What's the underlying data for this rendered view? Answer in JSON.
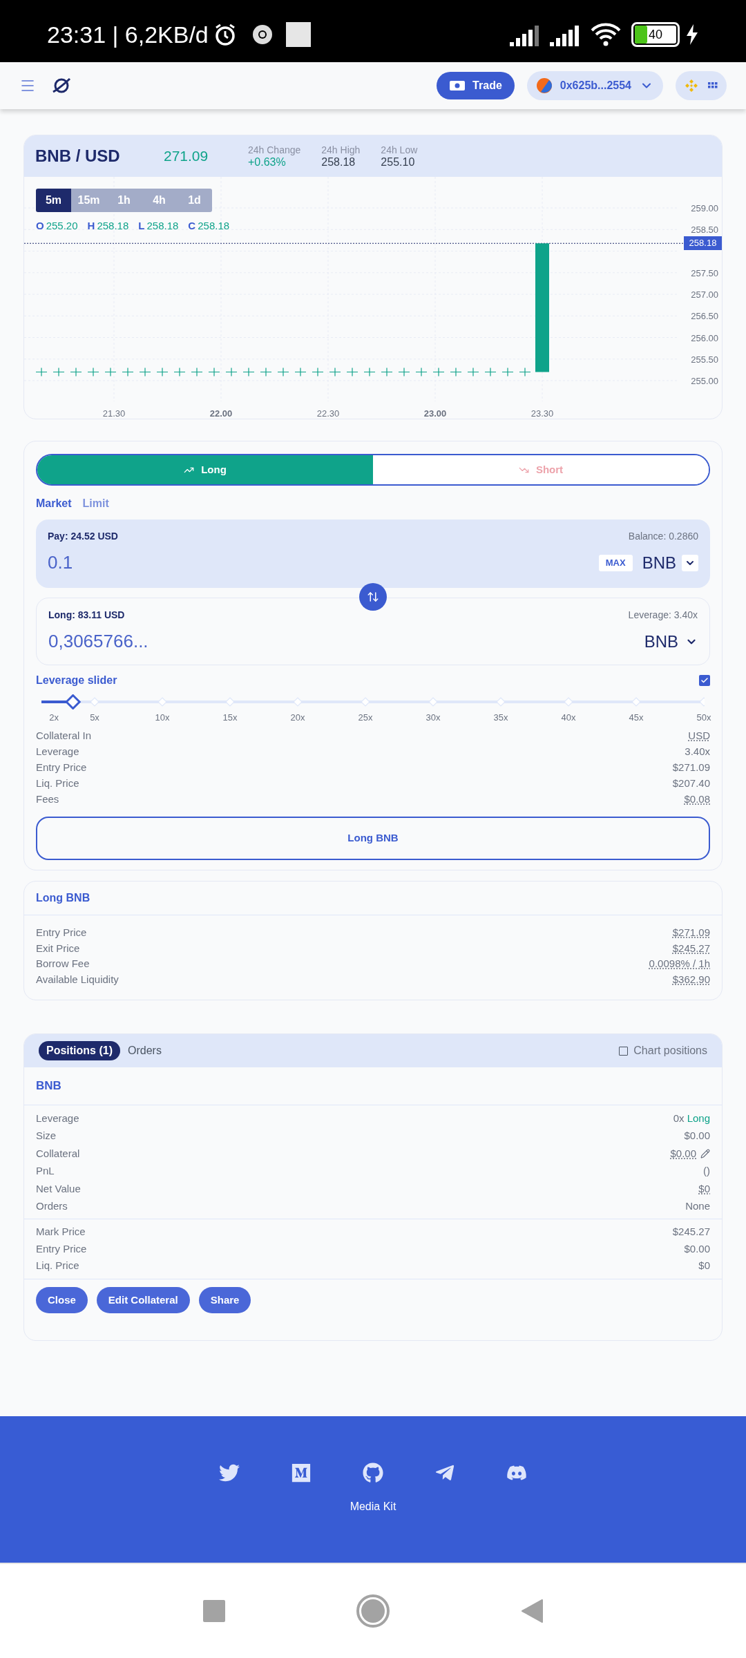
{
  "status_bar": {
    "time": "23:31 | 6,2KB/d",
    "battery": "40"
  },
  "header": {
    "trade_button": "Trade",
    "wallet": "0x625b...2554"
  },
  "market": {
    "pair": "BNB / USD",
    "price": "271.09",
    "stats": [
      {
        "label": "24h Change",
        "value": "+0.63%",
        "kind": "change"
      },
      {
        "label": "24h High",
        "value": "258.18",
        "kind": "plain"
      },
      {
        "label": "24h Low",
        "value": "255.10",
        "kind": "plain"
      }
    ]
  },
  "chart": {
    "timeframes": [
      {
        "label": "5m",
        "selected": true
      },
      {
        "label": "15m",
        "selected": false
      },
      {
        "label": "1h",
        "selected": false
      },
      {
        "label": "4h",
        "selected": false
      },
      {
        "label": "1d",
        "selected": false
      }
    ],
    "ohlc": [
      {
        "label": "O",
        "value": "255.20"
      },
      {
        "label": "H",
        "value": "258.18"
      },
      {
        "label": "L",
        "value": "258.18"
      },
      {
        "label": "C",
        "value": "258.18"
      }
    ],
    "y_labels": [
      "259.00",
      "258.50",
      "257.50",
      "257.00",
      "256.50",
      "256.00",
      "255.50",
      "255.00"
    ],
    "x_labels": [
      {
        "label": "21.30",
        "major": false
      },
      {
        "label": "22.00",
        "major": true
      },
      {
        "label": "22.30",
        "major": false
      },
      {
        "label": "23.00",
        "major": true
      },
      {
        "label": "23.30",
        "major": false
      }
    ],
    "price_tag": "258.18"
  },
  "trade": {
    "sides": [
      {
        "label": "Long",
        "kind": "long",
        "selected": true
      },
      {
        "label": "Short",
        "kind": "short",
        "selected": false
      }
    ],
    "order_types": [
      {
        "label": "Market",
        "selected": true
      },
      {
        "label": "Limit",
        "selected": false
      }
    ],
    "pay": {
      "label": "Pay: 24.52 USD",
      "balance": "Balance: 0.2860",
      "value": "0.1",
      "max": "MAX",
      "token": "BNB"
    },
    "receive": {
      "label": "Long: 83.11 USD",
      "leverage": "Leverage: 3.40x",
      "value": "0,3065766...",
      "token": "BNB"
    },
    "leverage_slider": {
      "label": "Leverage slider",
      "checked": true,
      "level": 0.068,
      "marks": [
        "2x",
        "5x",
        "10x",
        "15x",
        "20x",
        "25x",
        "30x",
        "35x",
        "40x",
        "45x",
        "50x"
      ]
    },
    "details": [
      {
        "label": "Collateral In",
        "value": "USD",
        "dotted": true
      },
      {
        "label": "Leverage",
        "value": "3.40x",
        "dotted": false
      },
      {
        "label": "Entry Price",
        "value": "$271.09",
        "dotted": false
      },
      {
        "label": "Liq. Price",
        "value": "$207.40",
        "dotted": false
      },
      {
        "label": "Fees",
        "value": "$0.08",
        "dotted": true
      }
    ],
    "submit": "Long BNB"
  },
  "info": {
    "title": "Long BNB",
    "rows": [
      {
        "label": "Entry Price",
        "value": "$271.09"
      },
      {
        "label": "Exit Price",
        "value": "$245.27"
      },
      {
        "label": "Borrow Fee",
        "value": "0.0098% / 1h"
      },
      {
        "label": "Available Liquidity",
        "value": "$362.90"
      }
    ]
  },
  "positions": {
    "tabs": [
      {
        "label": "Positions (1)",
        "selected": true
      },
      {
        "label": "Orders",
        "selected": false
      }
    ],
    "chart_positions": {
      "label": "Chart positions",
      "checked": false
    },
    "symbol": "BNB",
    "rows": [
      {
        "label": "Leverage",
        "value": "0x",
        "side": "Long",
        "kind": "leverage"
      },
      {
        "label": "Size",
        "value": "$0.00",
        "kind": "text"
      },
      {
        "label": "Collateral",
        "value": "$0.00",
        "kind": "editable"
      },
      {
        "label": "PnL",
        "value": "()",
        "kind": "text"
      },
      {
        "label": "Net Value",
        "value": "$0",
        "kind": "dotted"
      },
      {
        "label": "Orders",
        "value": "None",
        "kind": "text"
      }
    ],
    "price_rows": [
      {
        "label": "Mark Price",
        "value": "$245.27"
      },
      {
        "label": "Entry Price",
        "value": "$0.00"
      },
      {
        "label": "Liq. Price",
        "value": "$0"
      }
    ],
    "actions": [
      "Close",
      "Edit Collateral",
      "Share"
    ]
  },
  "footer": {
    "media_kit": "Media Kit"
  }
}
